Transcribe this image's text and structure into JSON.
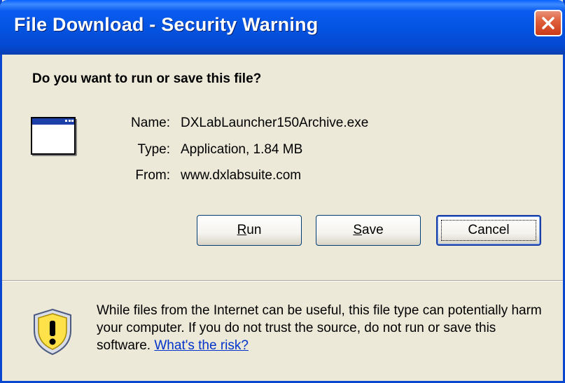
{
  "window": {
    "title": "File Download - Security Warning"
  },
  "dialog": {
    "question": "Do you want to run or save this file?",
    "file": {
      "name_label": "Name:",
      "name": "DXLabLauncher150Archive.exe",
      "type_label": "Type:",
      "type": "Application, 1.84 MB",
      "from_label": "From:",
      "from": "www.dxlabsuite.com"
    },
    "buttons": {
      "run_first": "R",
      "run_rest": "un",
      "save_first": "S",
      "save_rest": "ave",
      "cancel": "Cancel"
    },
    "warning": {
      "text": "While files from the Internet can be useful, this file type can potentially harm your computer. If you do not trust the source, do not run or save this software.",
      "link": "What's the risk?"
    }
  },
  "colors": {
    "title_bar": "#0453e0",
    "dialog_bg": "#ece9d8",
    "link": "#0033cc",
    "close_button": "#e0603c"
  },
  "icons": {
    "file": "application-window-icon",
    "warning": "security-shield-warning-icon",
    "close": "close-icon"
  }
}
